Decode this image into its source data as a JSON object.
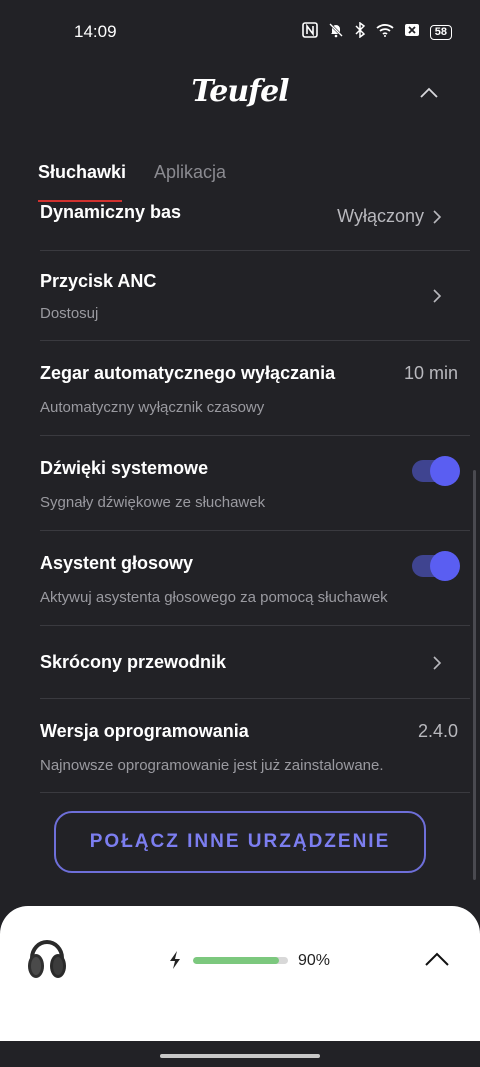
{
  "status_bar": {
    "time": "14:09",
    "icons": [
      "nfc-icon",
      "mute-icon",
      "bluetooth-icon",
      "wifi-icon",
      "close-box-icon"
    ],
    "battery": "58"
  },
  "header": {
    "brand": "Teufel",
    "collapse_icon": "chevron-up-icon"
  },
  "tabs": [
    {
      "label": "Słuchawki",
      "active": true
    },
    {
      "label": "Aplikacja",
      "active": false
    }
  ],
  "settings": {
    "dynamic_bass": {
      "title": "Dynamiczny bas",
      "value": "Wyłączony"
    },
    "anc_button": {
      "title": "Przycisk ANC",
      "subtitle": "Dostosuj"
    },
    "auto_off": {
      "title": "Zegar automatycznego wyłączania",
      "subtitle": "Automatyczny wyłącznik czasowy",
      "value": "10 min"
    },
    "system_sounds": {
      "title": "Dźwięki systemowe",
      "subtitle": "Sygnały dźwiękowe ze słuchawek",
      "enabled": true
    },
    "voice_assistant": {
      "title": "Asystent głosowy",
      "subtitle": "Aktywuj asystenta głosowego za pomocą słuchawek",
      "enabled": true
    },
    "quick_guide": {
      "title": "Skrócony przewodnik"
    },
    "firmware": {
      "title": "Wersja oprogramowania",
      "subtitle": "Najnowsze oprogramowanie jest już zainstalowane.",
      "value": "2.4.0"
    }
  },
  "connect_button": {
    "label": "POŁĄCZ INNE URZĄDZENIE"
  },
  "device_sheet": {
    "battery_percent": "90%",
    "battery_level": 0.9,
    "expand_icon": "chevron-up-icon"
  },
  "colors": {
    "background": "#222226",
    "accent": "#5a5ef2",
    "tab_underline": "#d2322f",
    "battery_fill": "#7cc87e"
  }
}
